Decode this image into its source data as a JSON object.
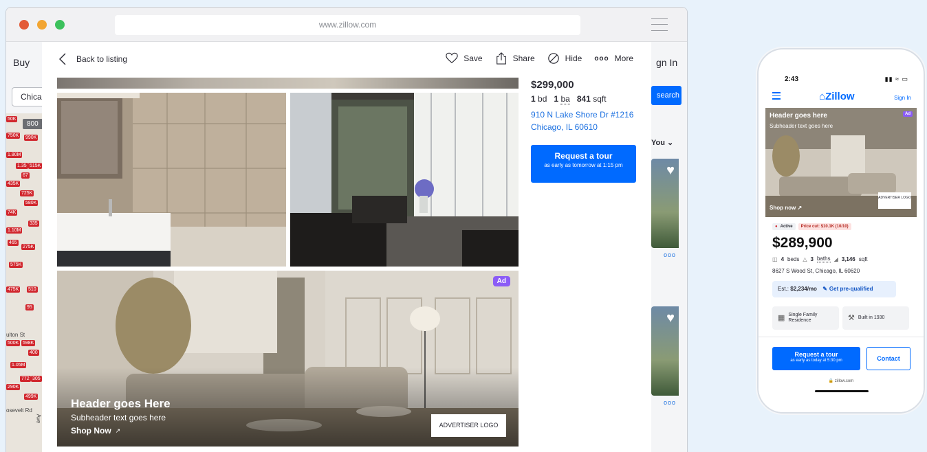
{
  "browser": {
    "url": "www.zillow.com",
    "colors": {
      "close": "#e35a37",
      "minimize": "#f2a532",
      "maximize": "#3cc15c"
    }
  },
  "background_page": {
    "nav_left": "Buy",
    "nav_right": "gn In",
    "search_value": "Chicag",
    "search_button": "search",
    "sort_label": "You",
    "zip_fragment": "0610",
    "map_pins": [
      "800",
      "50K",
      "990K",
      "750K",
      "1.80M",
      "1.35",
      "515K",
      "67",
      "435K",
      "725K",
      "580K",
      "74K",
      "335",
      "1.10M",
      "465",
      "275K",
      "575K",
      "475K",
      "510",
      "95",
      "500K",
      "598K",
      "400",
      "1.05M",
      "772",
      "305",
      "290K",
      "499K"
    ],
    "map_roads": [
      "ulton St",
      "osevelt Rd",
      "Ave"
    ]
  },
  "modal": {
    "back_label": "Back to listing",
    "actions": [
      {
        "icon": "heart-icon",
        "label": "Save"
      },
      {
        "icon": "share-icon",
        "label": "Share"
      },
      {
        "icon": "hide-icon",
        "label": "Hide"
      },
      {
        "icon": "more-dots-icon",
        "label": "More",
        "glyph": "ooo"
      }
    ],
    "listing": {
      "price": "$299,000",
      "beds": "1",
      "beds_unit": "bd",
      "baths": "1",
      "baths_unit": "ba",
      "sqft": "841",
      "sqft_unit": "sqft",
      "address_line1": "910 N Lake Shore Dr #1216",
      "address_line2": "Chicago, IL 60610",
      "tour_button": "Request a tour",
      "tour_sub": "as early as tomorrow at 1:15 pm"
    },
    "ad": {
      "badge": "Ad",
      "header": "Header goes Here",
      "subheader": "Subheader text goes here",
      "cta": "Shop Now",
      "advertiser_logo": "ADVERTISER LOGO"
    }
  },
  "phone": {
    "time": "2:43",
    "brand": "Zillow",
    "sign_in": "Sign In",
    "ad": {
      "header": "Header goes here",
      "subheader": "Subheader text goes here",
      "badge": "Ad",
      "cta": "Shop now",
      "advertiser_logo": "ADVERTISER LOGO"
    },
    "status_active": "Active",
    "price_cut": "Price cut: $10.1K (10/10)",
    "price": "$289,900",
    "beds": "4",
    "beds_unit": "beds",
    "baths": "3",
    "baths_unit": "baths",
    "sqft": "3,146",
    "sqft_unit": "sqft",
    "address": "8627 S Wood St, Chicago, IL 60620",
    "est_label": "Est.:",
    "est_value": "$2,234/mo",
    "prequal": "Get pre-qualified",
    "fact_type": "Single Family Residence",
    "fact_built": "Built in 1930",
    "tour_button": "Request a tour",
    "tour_sub": "as early as today at 5:30 pm",
    "contact_button": "Contact",
    "url": "zillow.com"
  }
}
